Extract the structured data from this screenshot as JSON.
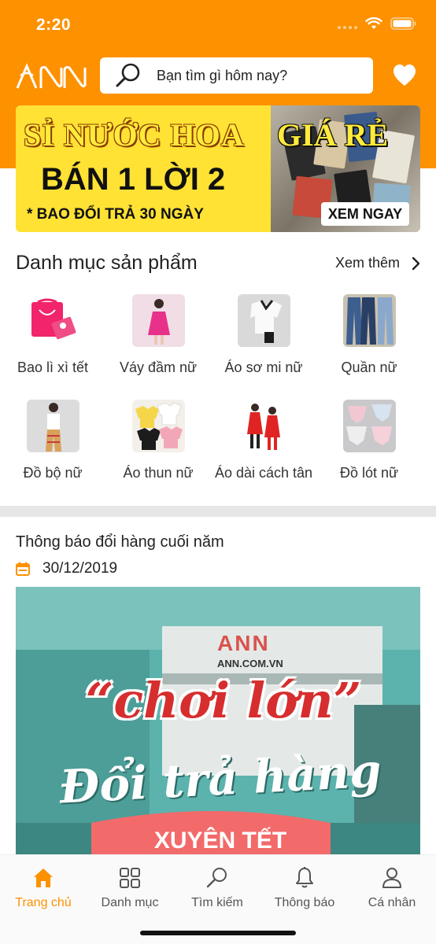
{
  "status_bar": {
    "time": "2:20"
  },
  "header": {
    "logo_text": "ANN",
    "search_placeholder": "Bạn tìm gì hôm nay?",
    "favorite_icon": "heart-icon"
  },
  "banner": {
    "line1_left": "SỈ NƯỚC HOA",
    "line1_right": "GIÁ RẺ",
    "line2": "BÁN 1 LỜI 2",
    "line3": "* BAO ĐỔI TRẢ 30 NGÀY",
    "cta": "XEM NGAY"
  },
  "categories": {
    "title": "Danh mục sản phẩm",
    "see_more": "Xem thêm",
    "items": [
      {
        "label": "Bao lì xì tết"
      },
      {
        "label": "Váy đầm nữ"
      },
      {
        "label": "Áo sơ mi nữ"
      },
      {
        "label": "Quần nữ"
      },
      {
        "label": "Đồ bộ nữ"
      },
      {
        "label": "Áo thun nữ"
      },
      {
        "label": "Áo dài cách tân"
      },
      {
        "label": "Đồ lót nữ"
      }
    ]
  },
  "news": {
    "title": "Thông báo đổi hàng cuối năm",
    "date": "30/12/2019",
    "image_text_1": "“chơi lớn”",
    "image_text_2": "Đổi trả hàng",
    "image_text_3": "XUYÊN TẾT",
    "image_brand": "ANN",
    "image_domain": "ANN.COM.VN"
  },
  "tabbar": {
    "items": [
      {
        "label": "Trang chủ",
        "icon": "home-icon"
      },
      {
        "label": "Danh mục",
        "icon": "grid-icon"
      },
      {
        "label": "Tìm kiếm",
        "icon": "search-icon"
      },
      {
        "label": "Thông báo",
        "icon": "bell-icon"
      },
      {
        "label": "Cá nhân",
        "icon": "user-icon"
      }
    ]
  },
  "colors": {
    "brand": "#FD9100",
    "banner_yellow": "#FFE234",
    "divider": "#E6E6E6"
  }
}
